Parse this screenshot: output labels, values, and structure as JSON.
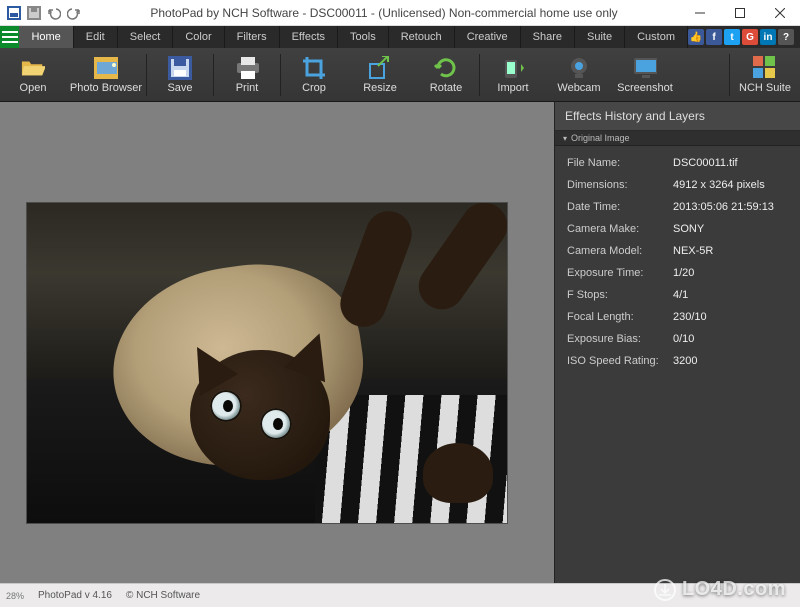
{
  "titlebar": {
    "title": "PhotoPad by NCH Software - DSC00011 - (Unlicensed) Non-commercial home use only"
  },
  "menu": {
    "tabs": [
      "Home",
      "Edit",
      "Select",
      "Color",
      "Filters",
      "Effects",
      "Tools",
      "Retouch",
      "Creative",
      "Share",
      "Suite",
      "Custom"
    ],
    "active_index": 0
  },
  "ribbon": {
    "open": "Open",
    "browser": "Photo Browser",
    "save": "Save",
    "print": "Print",
    "crop": "Crop",
    "resize": "Resize",
    "rotate": "Rotate",
    "import": "Import",
    "webcam": "Webcam",
    "screenshot": "Screenshot",
    "nchsuite": "NCH Suite"
  },
  "panel": {
    "title": "Effects History and Layers",
    "subheader": "Original Image",
    "metadata": [
      {
        "key": "File Name:",
        "val": "DSC00011.tif"
      },
      {
        "key": "Dimensions:",
        "val": "4912 x 3264 pixels"
      },
      {
        "key": "Date Time:",
        "val": "2013:05:06 21:59:13"
      },
      {
        "key": "Camera Make:",
        "val": "SONY"
      },
      {
        "key": "Camera Model:",
        "val": "NEX-5R"
      },
      {
        "key": "Exposure Time:",
        "val": "1/20"
      },
      {
        "key": "F Stops:",
        "val": "4/1"
      },
      {
        "key": "Focal Length:",
        "val": "230/10"
      },
      {
        "key": "Exposure Bias:",
        "val": "0/10"
      },
      {
        "key": "ISO Speed Rating:",
        "val": "3200"
      }
    ]
  },
  "statusbar": {
    "zoom": "28%",
    "app": "PhotoPad v 4.16",
    "vendor": "© NCH Software"
  },
  "watermark": "LO4D.com",
  "social": [
    {
      "name": "like",
      "bg": "#3b5998",
      "txt": "👍"
    },
    {
      "name": "facebook",
      "bg": "#3b5998",
      "txt": "f"
    },
    {
      "name": "twitter",
      "bg": "#1da1f2",
      "txt": "t"
    },
    {
      "name": "google",
      "bg": "#dd4b39",
      "txt": "G"
    },
    {
      "name": "linkedin",
      "bg": "#0077b5",
      "txt": "in"
    },
    {
      "name": "help",
      "bg": "#555",
      "txt": "?"
    }
  ]
}
